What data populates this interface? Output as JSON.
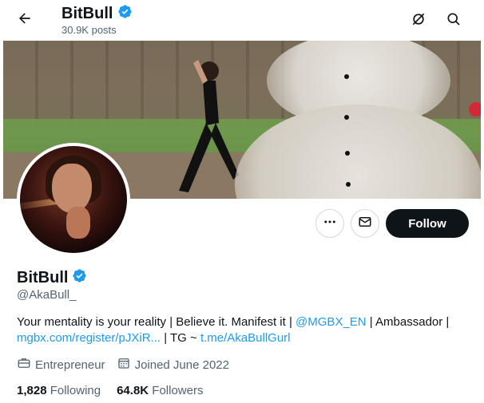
{
  "header": {
    "name": "BitBull",
    "posts": "30.9K posts"
  },
  "icons": {
    "back": "arrow-left-icon",
    "verified": "verified-badge-icon",
    "monitor": "slashed-circle-icon",
    "search": "search-icon",
    "more": "more-icon",
    "message": "mail-icon",
    "profession": "briefcase-icon",
    "calendar": "calendar-icon"
  },
  "actions": {
    "follow_label": "Follow"
  },
  "profile": {
    "name": "BitBull",
    "handle": "@AkaBull_",
    "bio": {
      "part1": "Your mentality is your reality | Believe it. Manifest it | ",
      "mention": "@MGBX_EN",
      "part2": " | Ambassador | ",
      "link1": "mgbx.com/register/pJXiR...",
      "part3": " | TG ~ ",
      "link2": "t.me/AkaBullGurl"
    },
    "profession": "Entrepreneur",
    "joined": "Joined June 2022",
    "following_count": "1,828",
    "following_label": "Following",
    "followers_count": "64.8K",
    "followers_label": "Followers"
  },
  "colors": {
    "accent": "#1d9bf0",
    "text": "#0f1419",
    "muted": "#536471",
    "follow_bg": "#0f1419"
  }
}
